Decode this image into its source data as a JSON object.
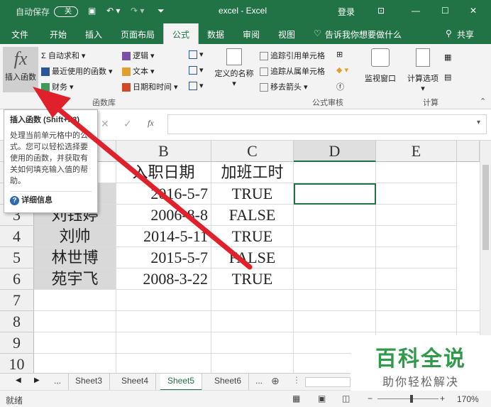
{
  "titlebar": {
    "autosave_label": "自动保存",
    "autosave_state": "关",
    "doc_title": "excel  -  Excel",
    "login": "登录"
  },
  "tabs": [
    "文件",
    "开始",
    "插入",
    "页面布局",
    "公式",
    "数据",
    "审阅",
    "视图"
  ],
  "tell_me": "告诉我你想要做什么",
  "share": "共享",
  "ribbon": {
    "insert_function": "插入函数",
    "autosum": "自动求和",
    "recent": "最近使用的函数",
    "finance": "财务",
    "logic": "逻辑",
    "text": "文本",
    "datetime": "日期和时间",
    "defined_names": "定义的名称",
    "trace_precedents": "追踪引用单元格",
    "trace_dependents": "追踪从属单元格",
    "remove_arrows": "移去箭头",
    "watch_window": "监视窗口",
    "calc_options": "计算选项",
    "group_library": "函数库",
    "group_audit": "公式审核",
    "group_calc": "计算"
  },
  "formula": {
    "fx": "fx"
  },
  "tooltip": {
    "title": "插入函数 (Shift+F3)",
    "body": "处理当前单元格中的公式。您可以轻松选择要使用的函数，并获取有关如何填充输入值的帮助。",
    "more": "详细信息"
  },
  "columns": [
    "B",
    "C",
    "D",
    "E"
  ],
  "rows": [
    "3",
    "4",
    "5",
    "6",
    "7",
    "8",
    "9",
    "10"
  ],
  "table": {
    "header": [
      "入职日期",
      "加班工时"
    ],
    "data": [
      {
        "name": "",
        "date": "2016-5-7",
        "ot": "TRUE"
      },
      {
        "name": "刘钰婷",
        "date": "2006-8-8",
        "ot": "FALSE"
      },
      {
        "name": "刘帅",
        "date": "2014-5-11",
        "ot": "TRUE"
      },
      {
        "name": "林世博",
        "date": "2015-5-7",
        "ot": "FALSE"
      },
      {
        "name": "苑宇飞",
        "date": "2008-3-22",
        "ot": "TRUE"
      }
    ]
  },
  "sheets": [
    "...",
    "Sheet3",
    "Sheet4",
    "Sheet5",
    "Sheet6",
    "..."
  ],
  "status": {
    "ready": "就绪",
    "zoom": "170%"
  },
  "watermark": {
    "title": "百科全说",
    "subtitle": "助你轻松解决"
  },
  "colors": {
    "excel_green": "#217346",
    "arrow": "#e0202a"
  }
}
